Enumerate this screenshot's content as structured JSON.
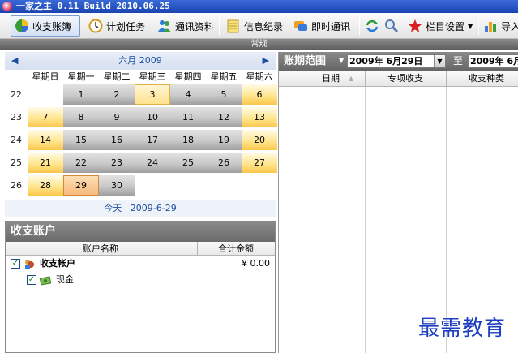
{
  "window": {
    "title": "一家之主 0.11 Build 2010.06.25",
    "icon": "app-icon"
  },
  "toolbar": {
    "items": [
      {
        "label": "收支账簿",
        "icon": "pie-chart-icon",
        "active": true
      },
      {
        "label": "计划任务",
        "icon": "clock-icon"
      },
      {
        "label": "通讯资料",
        "icon": "contacts-icon"
      },
      {
        "label": "信息纪录",
        "icon": "notepad-icon"
      },
      {
        "label": "即时通讯",
        "icon": "chat-icon"
      },
      {
        "label": "栏目设置",
        "icon": "star-icon"
      },
      {
        "label": "导入",
        "icon": "bar-chart-icon"
      }
    ],
    "strip_label": "常规"
  },
  "calendar": {
    "month_label": "六月 2009",
    "prev": "◀",
    "next": "▶",
    "day_names": [
      "星期日",
      "星期一",
      "星期二",
      "星期三",
      "星期四",
      "星期五",
      "星期六"
    ],
    "weeks": [
      {
        "wk": "22",
        "days": [
          "",
          "1",
          "2",
          "3",
          "4",
          "5",
          "6"
        ]
      },
      {
        "wk": "23",
        "days": [
          "7",
          "8",
          "9",
          "10",
          "11",
          "12",
          "13"
        ]
      },
      {
        "wk": "24",
        "days": [
          "14",
          "15",
          "16",
          "17",
          "18",
          "19",
          "20"
        ]
      },
      {
        "wk": "25",
        "days": [
          "21",
          "22",
          "23",
          "24",
          "25",
          "26",
          "27"
        ]
      },
      {
        "wk": "26",
        "days": [
          "28",
          "29",
          "30",
          "",
          "",
          "",
          ""
        ]
      }
    ],
    "today_label": "今天",
    "today_date": "2009-6-29",
    "selected_day": "29",
    "highlighted_day": "3"
  },
  "accounts": {
    "title": "收支账户",
    "col_name": "账户名称",
    "col_total": "合计金额",
    "root": {
      "name": "收支帐户",
      "amount": "¥ 0.00",
      "checked": true
    },
    "children": [
      {
        "name": "现金",
        "checked": true
      }
    ]
  },
  "range": {
    "label": "账期范围",
    "start": "2009年 6月29日",
    "to": "至",
    "end": "2009年 6月"
  },
  "grid": {
    "columns": [
      "日期",
      "专项收支",
      "收支种类"
    ],
    "sort_indicator": "▲"
  },
  "watermark": "最需教育",
  "colors": {
    "accent": "#1d4fa0",
    "highlight": "#ffe690",
    "watermark": "#1c3fbf"
  }
}
